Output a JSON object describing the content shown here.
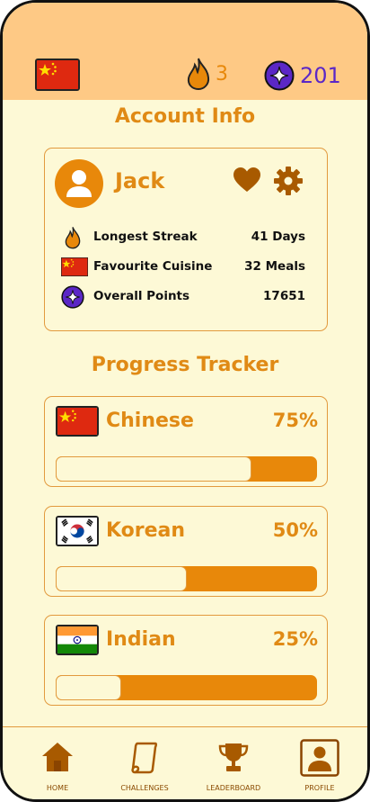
{
  "header": {
    "flag": "china-flag",
    "streak_count": "3",
    "points_count": "201"
  },
  "account": {
    "title": "Account Info",
    "username": "Jack",
    "stats": [
      {
        "label": "Longest Streak",
        "value": "41 Days",
        "icon": "flame-icon"
      },
      {
        "label": "Favourite Cuisine",
        "value": "32 Meals",
        "icon": "china-flag"
      },
      {
        "label": "Overall Points",
        "value": "17651",
        "icon": "star-badge-icon"
      }
    ]
  },
  "progress": {
    "title": "Progress Tracker",
    "items": [
      {
        "name": "Chinese",
        "percent_label": "75%",
        "percent": 75,
        "flag": "china-flag"
      },
      {
        "name": "Korean",
        "percent_label": "50%",
        "percent": 50,
        "flag": "korea-flag"
      },
      {
        "name": "Indian",
        "percent_label": "25%",
        "percent": 25,
        "flag": "india-flag"
      }
    ]
  },
  "nav": {
    "items": [
      {
        "label": "HOME",
        "icon": "home-icon"
      },
      {
        "label": "CHALLENGES",
        "icon": "scroll-icon"
      },
      {
        "label": "LEADERBOARD",
        "icon": "trophy-icon"
      },
      {
        "label": "PROFILE",
        "icon": "profile-icon"
      }
    ]
  },
  "colors": {
    "accent": "#e8880a",
    "header_bg": "#fec985",
    "page_bg": "#fdf9d6",
    "points_purple": "#5b27c6"
  }
}
